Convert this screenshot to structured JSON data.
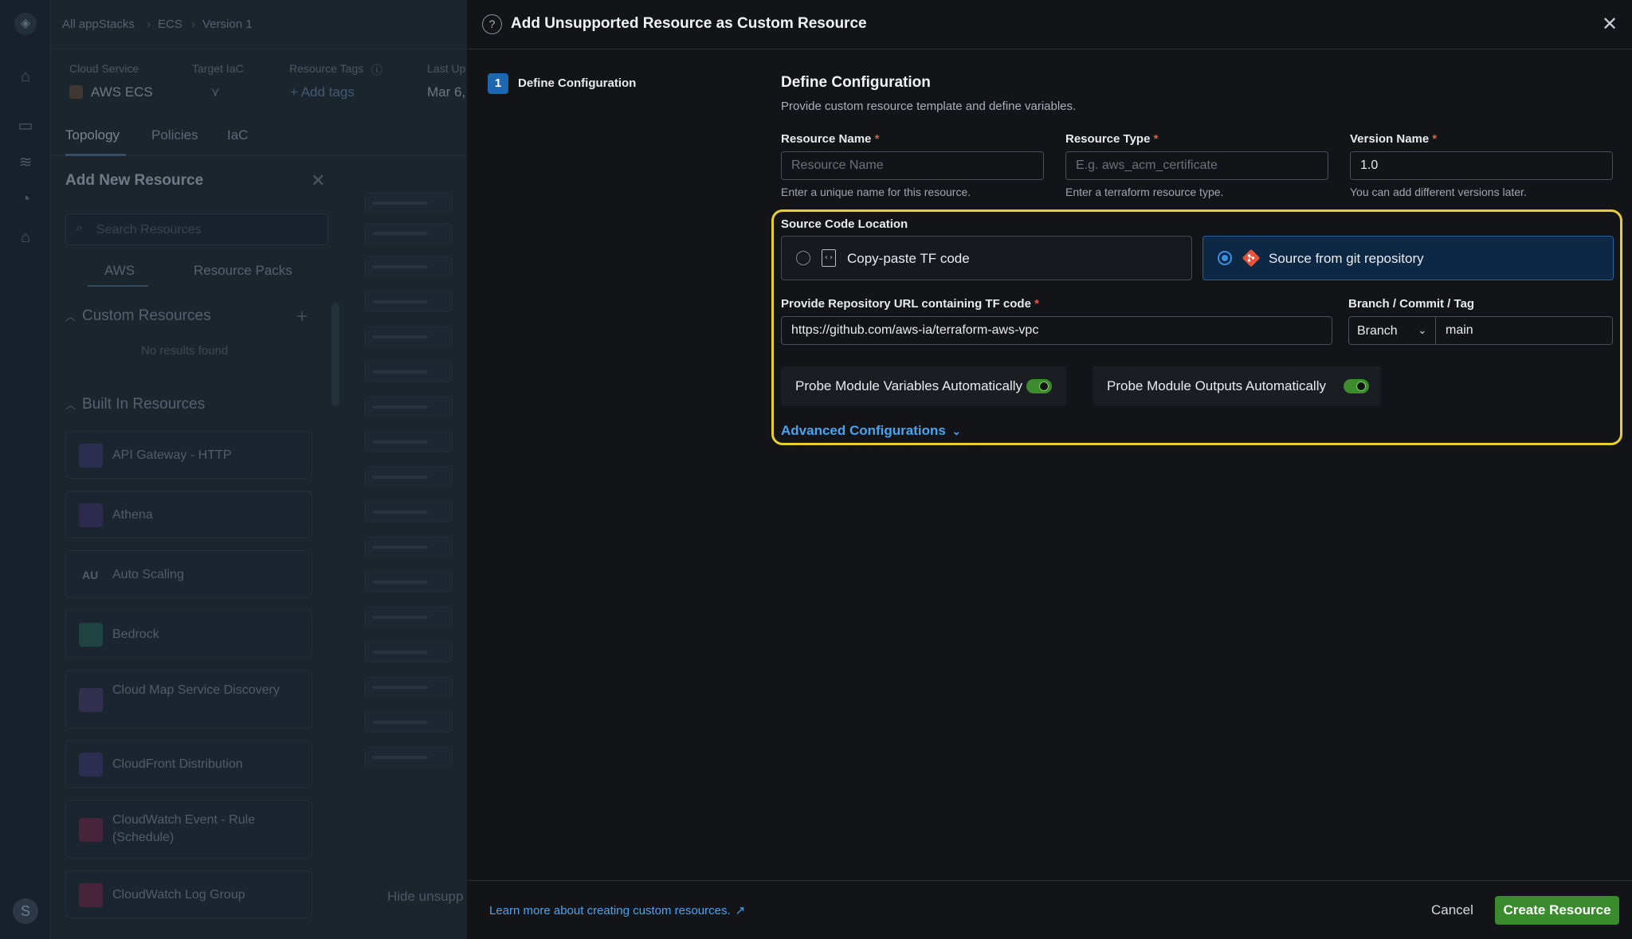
{
  "background": {
    "breadcrumb": [
      "All appStacks",
      "ECS",
      "Version 1"
    ],
    "meta": {
      "cloud_service_label": "Cloud Service",
      "cloud_service_value": "AWS ECS",
      "target_iac_label": "Target IaC",
      "resource_tags_label": "Resource Tags",
      "add_tags": "+ Add tags",
      "last_updated_label": "Last Up",
      "last_updated_value": "Mar 6,"
    },
    "tabs": [
      "Topology",
      "Policies",
      "IaC"
    ],
    "panel_title": "Add New Resource",
    "search_placeholder": "Search Resources",
    "subtabs": [
      "AWS",
      "Resource Packs"
    ],
    "custom_section": "Custom Resources",
    "no_results": "No results found",
    "builtin_section": "Built In Resources",
    "resources": [
      {
        "label": "API Gateway - HTTP",
        "color": "#3d3a6e"
      },
      {
        "label": "Athena",
        "color": "#3a3468"
      },
      {
        "label": "Auto Scaling",
        "color": "#1f2b36"
      },
      {
        "label": "Bedrock",
        "color": "#245b52"
      },
      {
        "label": "Cloud Map Service Discovery",
        "color": "#463a6a"
      },
      {
        "label": "CloudFront Distribution",
        "color": "#3d3a6e"
      },
      {
        "label": "CloudWatch Event - Rule (Schedule)",
        "color": "#6a2a4a"
      },
      {
        "label": "CloudWatch Log Group",
        "color": "#6a2a4a"
      }
    ],
    "au_badge": "AU",
    "hide_unsupported": "Hide unsupp",
    "avatar_letter": "S"
  },
  "modal": {
    "title": "Add Unsupported Resource as Custom Resource",
    "step_number": "1",
    "step_label": "Define Configuration",
    "section_title": "Define Configuration",
    "section_subtitle": "Provide custom resource template and define variables.",
    "fields": {
      "resource_name": {
        "label": "Resource Name",
        "placeholder": "Resource Name",
        "value": "",
        "hint": "Enter a unique name for this resource."
      },
      "resource_type": {
        "label": "Resource Type",
        "placeholder": "E.g. aws_acm_certificate",
        "value": "",
        "hint": "Enter a terraform resource type."
      },
      "version_name": {
        "label": "Version Name",
        "placeholder": "",
        "value": "1.0",
        "hint": "You can add different versions later."
      }
    },
    "required_mark": "*",
    "source_code_location": {
      "label": "Source Code Location",
      "options": [
        {
          "label": "Copy-paste TF code",
          "selected": false
        },
        {
          "label": "Source from git repository",
          "selected": true
        }
      ]
    },
    "repo_url": {
      "label": "Provide Repository URL containing TF code",
      "value": "https://github.com/aws-ia/terraform-aws-vpc"
    },
    "branch": {
      "label": "Branch / Commit / Tag",
      "type_value": "Branch",
      "value": "main"
    },
    "toggles": [
      {
        "label": "Probe Module Variables Automatically",
        "on": true
      },
      {
        "label": "Probe Module Outputs Automatically",
        "on": true
      }
    ],
    "advanced_link": "Advanced Configurations",
    "footer": {
      "learn_more": "Learn more about creating custom resources.",
      "cancel": "Cancel",
      "create": "Create Resource"
    },
    "accent_color": "#3a8a2e",
    "highlight_color": "#e9cf2a"
  }
}
